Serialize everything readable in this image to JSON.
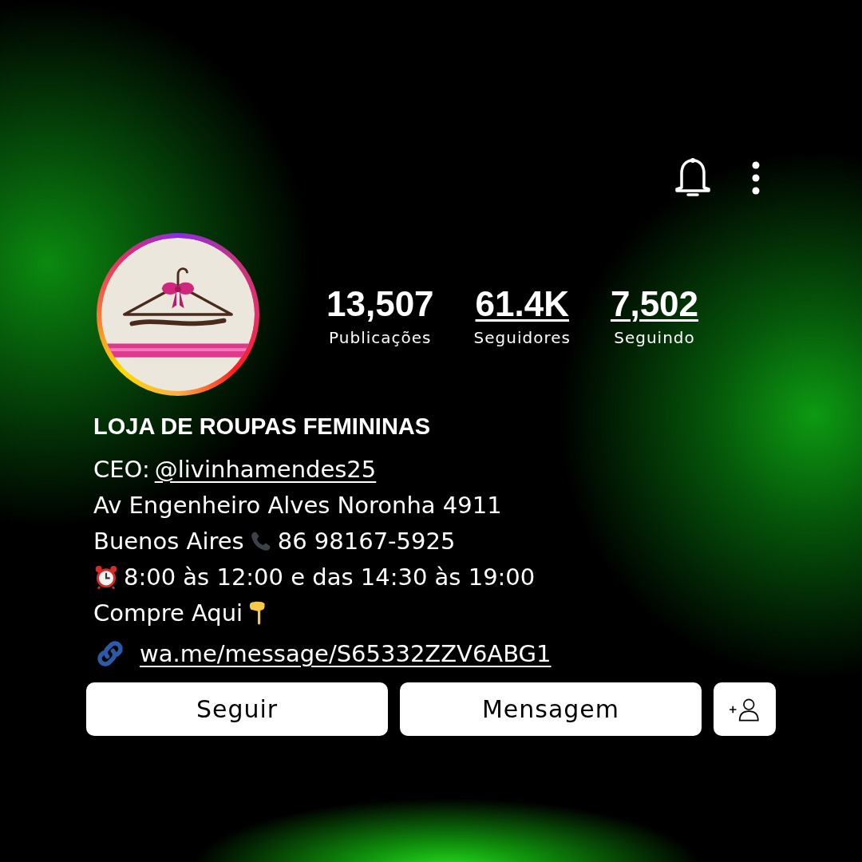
{
  "avatar": {
    "kind": "picture",
    "story_ring": true
  },
  "stats": [
    {
      "value": "13,507",
      "label": "Publicações",
      "link": false
    },
    {
      "value": "61.4K",
      "label": "Seguidores",
      "link": true
    },
    {
      "value": "7,502",
      "label": "Seguindo",
      "link": true
    }
  ],
  "name": "LOJA DE ROUPAS FEMININAS",
  "bio": [
    {
      "kind": "mention",
      "text": "CEO: ",
      "link": "@livinhamendes25"
    },
    {
      "kind": "plain",
      "text": "Av Engenheiro Alves Noronha 4911"
    },
    {
      "kind": "phone",
      "text": "Buenos Aires",
      "after": "86 98167-5925"
    },
    {
      "kind": "clock",
      "text": "8:00 às 12:00 e das 14:30 às 19:00"
    },
    {
      "kind": "pointer",
      "text": "Compre Aqui"
    }
  ],
  "link": "wa.me/message/S65332ZZV6ABG1",
  "buttons": [
    {
      "kind": "text",
      "label": "Seguir"
    },
    {
      "kind": "text",
      "label": "Mensagem"
    },
    {
      "kind": "add-person"
    }
  ]
}
